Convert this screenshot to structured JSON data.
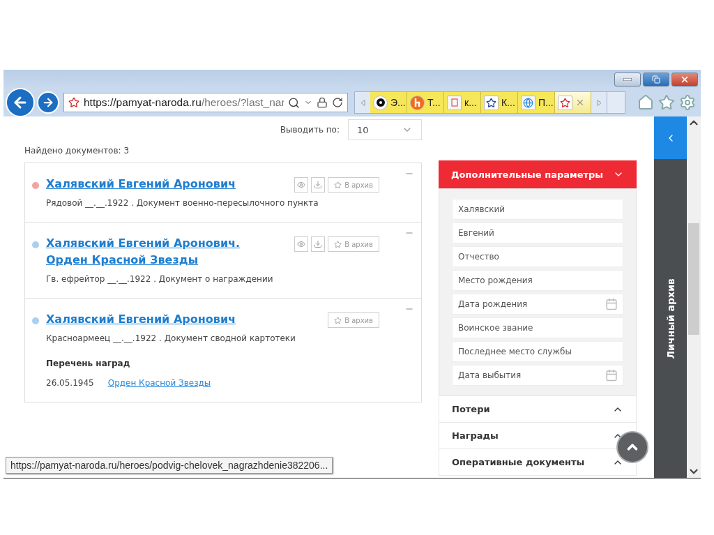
{
  "address_bar": {
    "host": "https://pamyat-naroda.ru",
    "path": "/heroes/?last_nar"
  },
  "tabs": [
    {
      "label": "Э...",
      "selected": false
    },
    {
      "label": "Т...",
      "selected": false
    },
    {
      "label": "к...",
      "selected": false
    },
    {
      "label": "К...",
      "selected": false
    },
    {
      "label": "П...",
      "selected": false
    },
    {
      "selected": true
    }
  ],
  "page_size": {
    "label": "Выводить по:",
    "value": "10"
  },
  "found": "Найдено документов: 3",
  "results": [
    {
      "title": "Халявский Евгений Аронович",
      "color": "#f2a3a3",
      "subtitle": "Рядовой __.__.1922 . Документ военно-пересылочного пункта",
      "view": true,
      "download": true,
      "archive": "В архив"
    },
    {
      "title": "Халявский Евгений Аронович. Орден Красной Звезды",
      "color": "#a9d0f2",
      "subtitle": "Гв. ефрейтор __.__.1922 . Документ о награждении",
      "view": true,
      "download": true,
      "archive": "В архив"
    },
    {
      "title": "Халявский Евгений Аронович",
      "color": "#a9d0f2",
      "subtitle": "Красноармеец __.__.1922 . Документ сводной картотеки",
      "archive": "В архив",
      "awards": {
        "heading": "Перечень наград",
        "items": [
          {
            "date": "26.05.1945",
            "name": "Орден Красной Звезды"
          }
        ]
      }
    }
  ],
  "filters": {
    "title": "Дополнительные параметры",
    "expanded": true,
    "fields": [
      {
        "kind": "text",
        "value": "Халявский"
      },
      {
        "kind": "text",
        "value": "Евгений"
      },
      {
        "kind": "text",
        "placeholder": "Отчество"
      },
      {
        "kind": "text",
        "placeholder": "Место рождения"
      },
      {
        "kind": "date",
        "placeholder": "Дата рождения"
      },
      {
        "kind": "text",
        "placeholder": "Воинское звание"
      },
      {
        "kind": "text",
        "placeholder": "Последнее место службы"
      },
      {
        "kind": "date",
        "placeholder": "Дата выбытия"
      }
    ]
  },
  "sections": [
    {
      "label": "Потери"
    },
    {
      "label": "Награды"
    },
    {
      "label": "Оперативные документы"
    }
  ],
  "side_tab": "Личный архив",
  "status_url": "https://pamyat-naroda.ru/heroes/podvig-chelovek_nagrazhdenie382206..."
}
